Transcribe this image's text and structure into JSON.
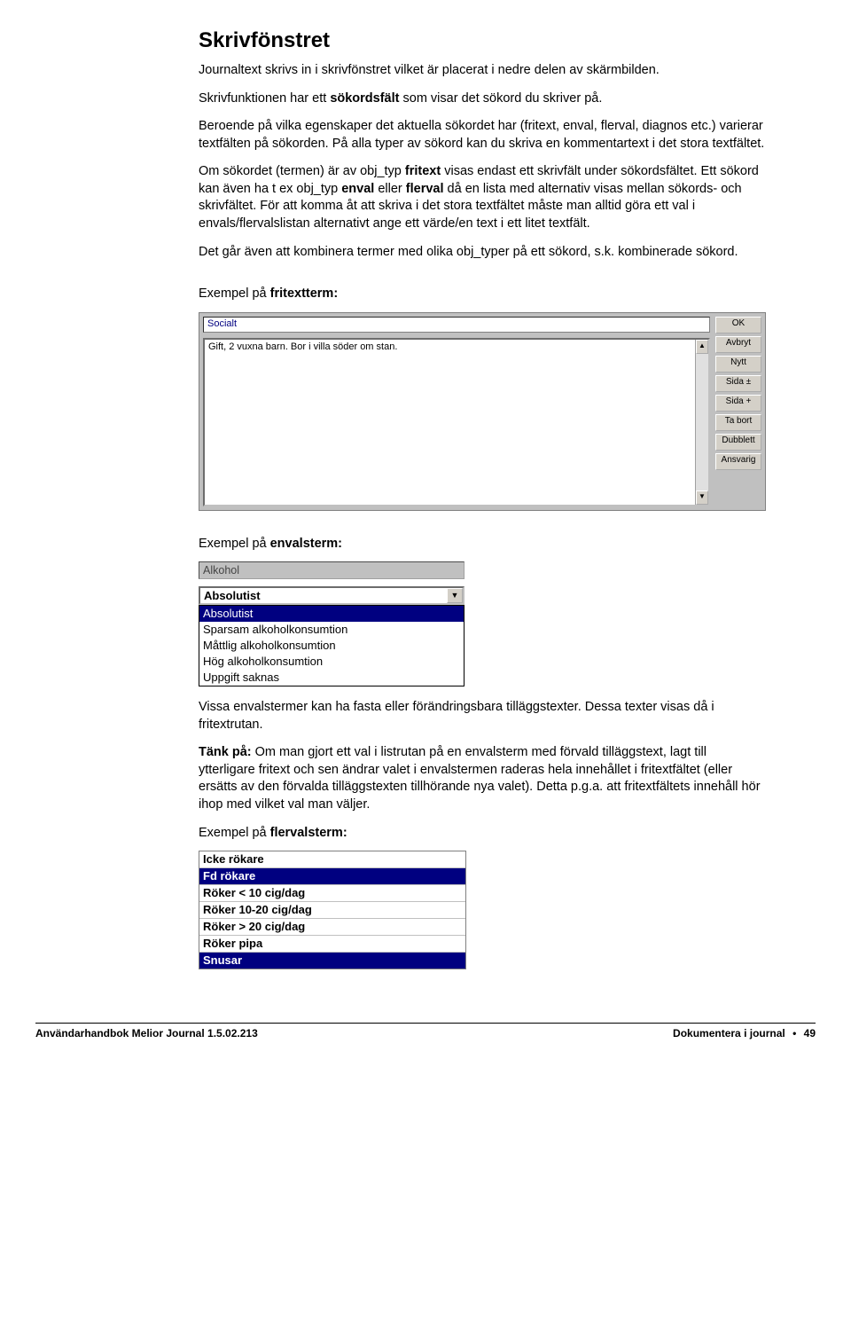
{
  "title": "Skrivfönstret",
  "para1": "Journaltext skrivs in i skrivfönstret vilket är placerat i nedre delen av skärmbilden.",
  "para2a": "Skrivfunktionen har ett ",
  "para2b": "sökordsfält",
  "para2c": " som visar det sökord du skriver på.",
  "para3": "Beroende på vilka egenskaper det aktuella sökordet har (fritext, enval, flerval, diagnos etc.) varierar textfälten på sökorden. På alla typer av sökord kan du skriva en kommentartext i det stora textfältet.",
  "para4a": "Om sökordet (termen) är av obj_typ ",
  "para4b": "fritext",
  "para4c": " visas endast ett skrivfält under sökordsfältet. Ett sökord kan även ha t ex obj_typ ",
  "para4d": "enval",
  "para4e": " eller ",
  "para4f": "flerval",
  "para4g": " då en lista med alternativ visas mellan sökords- och skrivfältet. För att komma åt att skriva i det stora textfältet måste man alltid göra ett val i envals/flervalslistan alternativt ange ett värde/en text i ett litet textfält.",
  "para5": "Det går även att kombinera termer med olika obj_typer på ett sökord, s.k. kombinerade sökord.",
  "ex_fritext_lbl_a": "Exempel på ",
  "ex_fritext_lbl_b": "fritextterm:",
  "fritext": {
    "field_label": "Socialt",
    "text": "Gift, 2 vuxna barn. Bor i villa söder om stan.",
    "buttons": [
      "OK",
      "Avbryt",
      "Nytt",
      "Sida ±",
      "Sida +",
      "Ta bort",
      "Dubblett",
      "Ansvarig"
    ]
  },
  "ex_enval_lbl_a": "Exempel på ",
  "ex_enval_lbl_b": "envalsterm:",
  "enval": {
    "label": "Alkohol",
    "selected": "Absolutist",
    "items": [
      "Absolutist",
      "Sparsam alkoholkonsumtion",
      "Måttlig alkoholkonsumtion",
      "Hög alkoholkonsumtion",
      "Uppgift saknas"
    ]
  },
  "para6": "Vissa envalstermer kan ha fasta eller förändringsbara tilläggstexter. Dessa texter visas då i fritextrutan.",
  "para7a": "Tänk på:",
  "para7b": " Om man gjort ett val i listrutan på en envalsterm med förvald tilläggstext, lagt till ytterligare fritext och sen ändrar valet i envalstermen raderas hela innehållet i fritextfältet (eller ersätts av den förvalda tilläggstexten tillhörande nya valet). Detta p.g.a. att fritextfältets innehåll hör ihop med vilket val man väljer.",
  "ex_flerval_lbl_a": "Exempel på ",
  "ex_flerval_lbl_b": "flervalsterm:",
  "flerval": {
    "items": [
      {
        "label": "Icke rökare",
        "sel": false
      },
      {
        "label": "Fd rökare",
        "sel": true
      },
      {
        "label": "Röker < 10 cig/dag",
        "sel": false
      },
      {
        "label": "Röker 10-20 cig/dag",
        "sel": false
      },
      {
        "label": "Röker > 20 cig/dag",
        "sel": false
      },
      {
        "label": "Röker pipa",
        "sel": false
      },
      {
        "label": "Snusar",
        "sel": true
      }
    ]
  },
  "footer": {
    "left": "Användarhandbok Melior Journal 1.5.02.213",
    "right_a": "Dokumentera i journal",
    "dot": "•",
    "right_b": "49"
  }
}
